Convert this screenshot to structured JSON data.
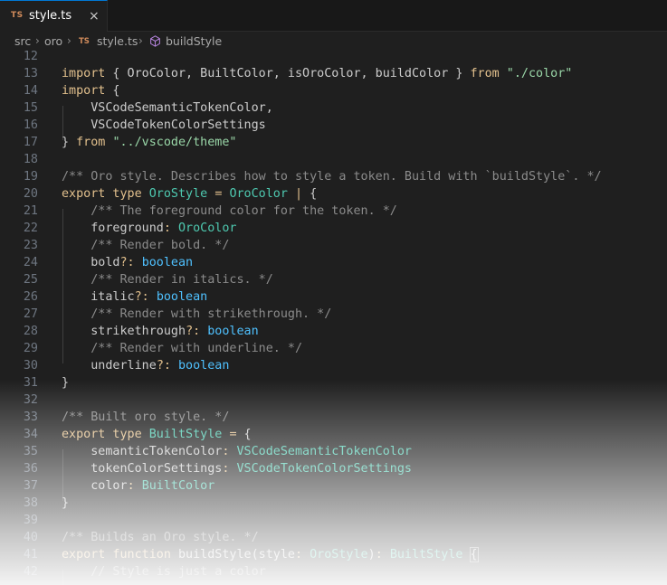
{
  "tab": {
    "badge": "TS",
    "label": "style.ts",
    "close": "×"
  },
  "breadcrumb": {
    "items": [
      "src",
      "oro",
      "style.ts",
      "buildStyle"
    ],
    "ts_badge": "TS",
    "separator": "›"
  },
  "lines": [
    {
      "n": "12",
      "tokens": []
    },
    {
      "n": "13",
      "tokens": [
        [
          "kw",
          "import"
        ],
        [
          "id",
          " { OroColor, BuiltColor, isOroColor, buildColor } "
        ],
        [
          "kw",
          "from"
        ],
        [
          "id",
          " "
        ],
        [
          "str",
          "\"./color\""
        ]
      ]
    },
    {
      "n": "14",
      "tokens": [
        [
          "kw",
          "import"
        ],
        [
          "id",
          " {"
        ]
      ]
    },
    {
      "n": "15",
      "tokens": [
        [
          "id",
          "    VSCodeSemanticTokenColor,"
        ]
      ]
    },
    {
      "n": "16",
      "tokens": [
        [
          "id",
          "    VSCodeTokenColorSettings"
        ]
      ]
    },
    {
      "n": "17",
      "tokens": [
        [
          "id",
          "} "
        ],
        [
          "kw",
          "from"
        ],
        [
          "id",
          " "
        ],
        [
          "str",
          "\"../vscode/theme\""
        ]
      ]
    },
    {
      "n": "18",
      "tokens": []
    },
    {
      "n": "19",
      "tokens": [
        [
          "cm",
          "/** Oro style. Describes how to style a token. Build with `buildStyle`. */"
        ]
      ]
    },
    {
      "n": "20",
      "tokens": [
        [
          "kw",
          "export type"
        ],
        [
          "id",
          " "
        ],
        [
          "ty",
          "OroStyle"
        ],
        [
          "id",
          " "
        ],
        [
          "op",
          "="
        ],
        [
          "id",
          " "
        ],
        [
          "ty",
          "OroColor"
        ],
        [
          "id",
          " "
        ],
        [
          "op",
          "|"
        ],
        [
          "id",
          " {"
        ]
      ]
    },
    {
      "n": "21",
      "tokens": [
        [
          "id",
          "    "
        ],
        [
          "cm",
          "/** The foreground color for the token. */"
        ]
      ]
    },
    {
      "n": "22",
      "tokens": [
        [
          "id",
          "    foreground"
        ],
        [
          "op",
          ":"
        ],
        [
          "id",
          " "
        ],
        [
          "ty",
          "OroColor"
        ]
      ]
    },
    {
      "n": "23",
      "tokens": [
        [
          "id",
          "    "
        ],
        [
          "cm",
          "/** Render bold. */"
        ]
      ]
    },
    {
      "n": "24",
      "tokens": [
        [
          "id",
          "    bold"
        ],
        [
          "op",
          "?:"
        ],
        [
          "id",
          " "
        ],
        [
          "bool",
          "boolean"
        ]
      ]
    },
    {
      "n": "25",
      "tokens": [
        [
          "id",
          "    "
        ],
        [
          "cm",
          "/** Render in italics. */"
        ]
      ]
    },
    {
      "n": "26",
      "tokens": [
        [
          "id",
          "    italic"
        ],
        [
          "op",
          "?:"
        ],
        [
          "id",
          " "
        ],
        [
          "bool",
          "boolean"
        ]
      ]
    },
    {
      "n": "27",
      "tokens": [
        [
          "id",
          "    "
        ],
        [
          "cm",
          "/** Render with strikethrough. */"
        ]
      ]
    },
    {
      "n": "28",
      "tokens": [
        [
          "id",
          "    strikethrough"
        ],
        [
          "op",
          "?:"
        ],
        [
          "id",
          " "
        ],
        [
          "bool",
          "boolean"
        ]
      ]
    },
    {
      "n": "29",
      "tokens": [
        [
          "id",
          "    "
        ],
        [
          "cm",
          "/** Render with underline. */"
        ]
      ]
    },
    {
      "n": "30",
      "tokens": [
        [
          "id",
          "    underline"
        ],
        [
          "op",
          "?:"
        ],
        [
          "id",
          " "
        ],
        [
          "bool",
          "boolean"
        ]
      ]
    },
    {
      "n": "31",
      "tokens": [
        [
          "id",
          "}"
        ]
      ]
    },
    {
      "n": "32",
      "tokens": []
    },
    {
      "n": "33",
      "tokens": [
        [
          "cm",
          "/** Built oro style. */"
        ]
      ]
    },
    {
      "n": "34",
      "tokens": [
        [
          "kw",
          "export type"
        ],
        [
          "id",
          " "
        ],
        [
          "ty",
          "BuiltStyle"
        ],
        [
          "id",
          " "
        ],
        [
          "op",
          "="
        ],
        [
          "id",
          " {"
        ]
      ]
    },
    {
      "n": "35",
      "tokens": [
        [
          "id",
          "    semanticTokenColor"
        ],
        [
          "op",
          ":"
        ],
        [
          "id",
          " "
        ],
        [
          "ty",
          "VSCodeSemanticTokenColor"
        ]
      ]
    },
    {
      "n": "36",
      "tokens": [
        [
          "id",
          "    tokenColorSettings"
        ],
        [
          "op",
          ":"
        ],
        [
          "id",
          " "
        ],
        [
          "ty",
          "VSCodeTokenColorSettings"
        ]
      ]
    },
    {
      "n": "37",
      "tokens": [
        [
          "id",
          "    color"
        ],
        [
          "op",
          ":"
        ],
        [
          "id",
          " "
        ],
        [
          "ty",
          "BuiltColor"
        ]
      ]
    },
    {
      "n": "38",
      "tokens": [
        [
          "id",
          "}"
        ]
      ]
    },
    {
      "n": "39",
      "tokens": []
    },
    {
      "n": "40",
      "tokens": [
        [
          "cm",
          "/** Builds an Oro style. */"
        ]
      ]
    },
    {
      "n": "41",
      "tokens": [
        [
          "kw",
          "export function"
        ],
        [
          "id",
          " buildStyle(style"
        ],
        [
          "op",
          ":"
        ],
        [
          "id",
          " "
        ],
        [
          "ty",
          "OroStyle"
        ],
        [
          "id",
          ")"
        ],
        [
          "op",
          ":"
        ],
        [
          "id",
          " "
        ],
        [
          "ty",
          "BuiltStyle"
        ],
        [
          "id",
          " "
        ],
        [
          "bracket",
          "{"
        ]
      ]
    },
    {
      "n": "42",
      "tokens": [
        [
          "id",
          "    "
        ],
        [
          "cm",
          "// Style is just a color"
        ]
      ]
    }
  ]
}
